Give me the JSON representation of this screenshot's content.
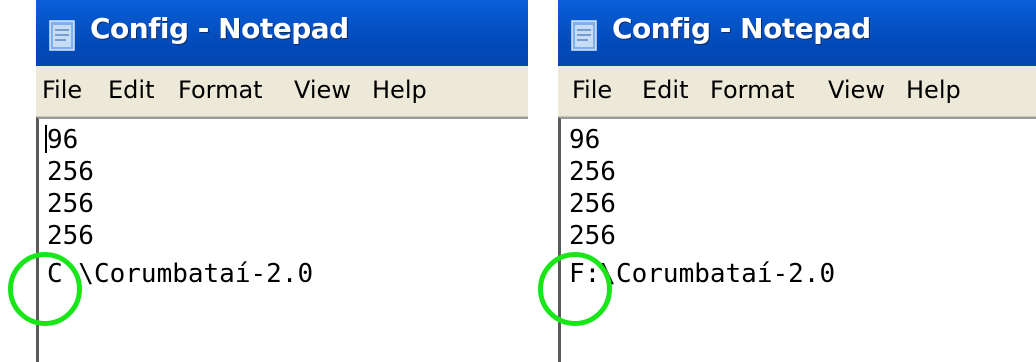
{
  "left_window": {
    "title": "Config - Notepad",
    "menu": [
      "File",
      "Edit",
      "Format",
      "View",
      "Help"
    ],
    "lines": [
      "96",
      "256",
      "256",
      "256",
      "C \\Corumbataí-2.0"
    ]
  },
  "right_window": {
    "title": "Config - Notepad",
    "menu": [
      "File",
      "Edit",
      "Format",
      "View",
      "Help"
    ],
    "lines": [
      "96",
      "256",
      "256",
      "256",
      "F:\\Corumbataí-2.0"
    ]
  },
  "highlight_color": "#19e619",
  "icons": {
    "app": "notepad-icon",
    "highlight": "highlight-circle"
  }
}
